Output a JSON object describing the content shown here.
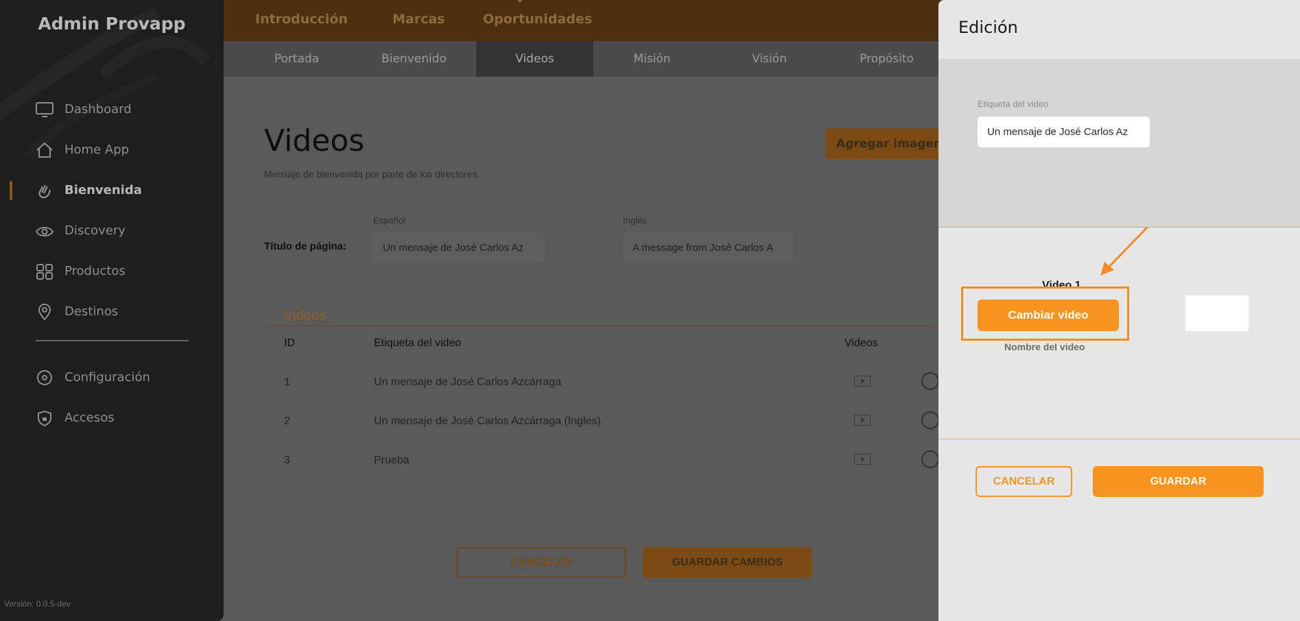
{
  "sidebar": {
    "brand": "Admin Provapp",
    "items": [
      {
        "label": "Dashboard",
        "icon": "monitor-icon"
      },
      {
        "label": "Home App",
        "icon": "home-icon"
      },
      {
        "label": "Bienvenida",
        "icon": "wave-hand-icon",
        "active": true
      },
      {
        "label": "Discovery",
        "icon": "eye-icon"
      },
      {
        "label": "Productos",
        "icon": "grid-icon"
      },
      {
        "label": "Destinos",
        "icon": "location-pin-icon"
      }
    ],
    "bottom_items": [
      {
        "label": "Configuración",
        "icon": "settings-icon"
      },
      {
        "label": "Accesos",
        "icon": "shield-icon"
      }
    ],
    "version": "Versión: 0.0.5-dev"
  },
  "topnav": {
    "tabs": [
      "Introducción",
      "Marcas",
      "Oportunidades"
    ]
  },
  "subnav": {
    "tabs": [
      "Portada",
      "Bienvenido",
      "Videos",
      "Misión",
      "Visión",
      "Propósito"
    ],
    "active": "Videos"
  },
  "main": {
    "title": "Videos",
    "subtitle": "Mensaje de bienvenida por parte de los directores.",
    "add_button": "Agregar imagen",
    "page_title_label": "Título de página:",
    "spanish_label": "Español",
    "english_label": "Inglés",
    "spanish_value": "Un mensaje de José Carlos Az",
    "english_value": "A message from José Carlos A",
    "section_title": "Videos",
    "table": {
      "headers": [
        "ID",
        "Etiqueta del video",
        "Videos"
      ],
      "rows": [
        {
          "id": "1",
          "label": "Un mensaje de José Carlos Azcárraga"
        },
        {
          "id": "2",
          "label": "Un mensaje de José Carlos Azcárraga (Ingles)"
        },
        {
          "id": "3",
          "label": "Prueba"
        }
      ]
    },
    "cancel_button": "CANCELAR",
    "save_button": "GUARDAR CAMBIOS"
  },
  "drawer": {
    "title": "Edición",
    "field_label": "Etiqueta del video",
    "field_value": "Un mensaje de José Carlos Az",
    "video_heading": "Video 1",
    "change_button": "Cambiar video",
    "video_name_label": "Nombre del video",
    "cancel_button": "CANCELAR",
    "save_button": "GUARDAR"
  },
  "colors": {
    "accent": "#f7941d",
    "highlight": "#f28c28",
    "sidebar_bg": "#1e1e1e",
    "drawer_bg": "#e7e7e7"
  }
}
